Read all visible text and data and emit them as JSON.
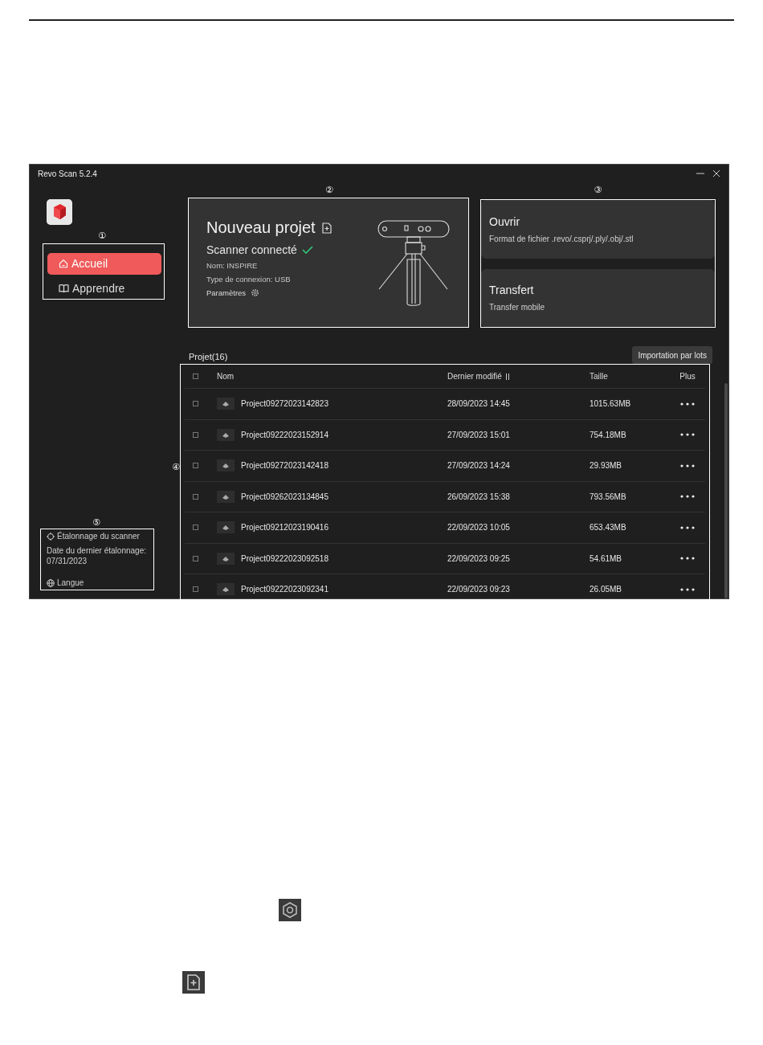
{
  "window": {
    "title": "Revo Scan 5.2.4"
  },
  "callouts": [
    "①",
    "②",
    "③",
    "④",
    "⑤"
  ],
  "sidebar": {
    "items": [
      {
        "label": "Accueil",
        "selected": true
      },
      {
        "label": "Apprendre",
        "selected": false
      }
    ],
    "calibration": "Étalonnage du scanner",
    "last_calibration_label": "Date du dernier étalonnage:",
    "last_calibration_date": "07/31/2023",
    "language": "Langue"
  },
  "new_project": {
    "title": "Nouveau projet",
    "status": "Scanner connecté",
    "connected": true,
    "name": "Nom: INSPIRE",
    "connection": "Type de connexion: USB",
    "settings": "Paramètres"
  },
  "open": {
    "title": "Ouvrir",
    "subtitle": "Format de fichier .revo/.csprj/.ply/.obj/.stl"
  },
  "transfer": {
    "title": "Transfert",
    "subtitle": "Transfer mobile"
  },
  "projects": {
    "title": "Projet(16)",
    "import_button": "Importation par lots",
    "all_checked": false,
    "columns": [
      "Nom",
      "Dernier modifié",
      "Taille",
      "Plus"
    ],
    "rows": [
      {
        "name": "Project09272023142823",
        "modified": "28/09/2023 14:45",
        "size": "1015.63MB",
        "checked": false
      },
      {
        "name": "Project09222023152914",
        "modified": "27/09/2023 15:01",
        "size": "754.18MB",
        "checked": false
      },
      {
        "name": "Project09272023142418",
        "modified": "27/09/2023 14:24",
        "size": "29.93MB",
        "checked": false
      },
      {
        "name": "Project09262023134845",
        "modified": "26/09/2023 15:38",
        "size": "793.56MB",
        "checked": false
      },
      {
        "name": "Project09212023190416",
        "modified": "22/09/2023 10:05",
        "size": "653.43MB",
        "checked": false
      },
      {
        "name": "Project09222023092518",
        "modified": "22/09/2023 09:25",
        "size": "54.61MB",
        "checked": false
      },
      {
        "name": "Project09222023092341",
        "modified": "22/09/2023 09:23",
        "size": "26.05MB",
        "checked": false
      }
    ]
  }
}
